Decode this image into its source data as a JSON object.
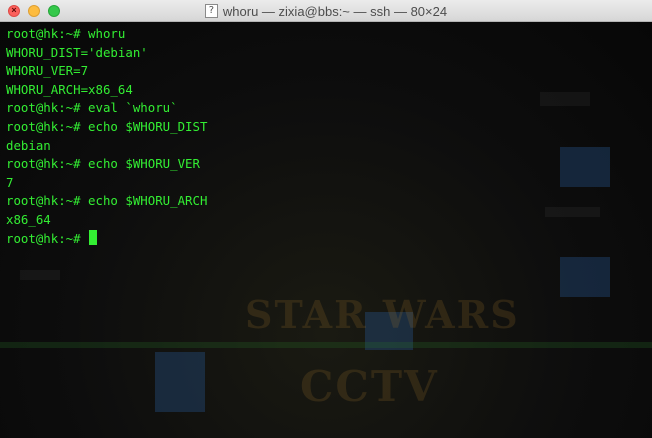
{
  "window": {
    "title": "whoru — zixia@bbs:~ — ssh — 80×24",
    "doc_icon": "?"
  },
  "terminal": {
    "lines": [
      "root@hk:~# whoru",
      "WHORU_DIST='debian'",
      "WHORU_VER=7",
      "WHORU_ARCH=x86_64",
      "root@hk:~# eval `whoru`",
      "root@hk:~# echo $WHORU_DIST",
      "debian",
      "root@hk:~# echo $WHORU_VER",
      "7",
      "root@hk:~# echo $WHORU_ARCH",
      "x86_64",
      "root@hk:~# "
    ]
  },
  "background": {
    "wordmark_1": "STAR WARS",
    "wordmark_2": "CCTV"
  },
  "colors": {
    "text": "#33ee33",
    "cursor": "#33ee33",
    "close": "#fc605c",
    "minimize": "#fdbc40",
    "zoom": "#34c84a"
  },
  "icons": [
    "close-icon",
    "minimize-icon",
    "zoom-icon",
    "document-icon",
    "cursor-block"
  ]
}
